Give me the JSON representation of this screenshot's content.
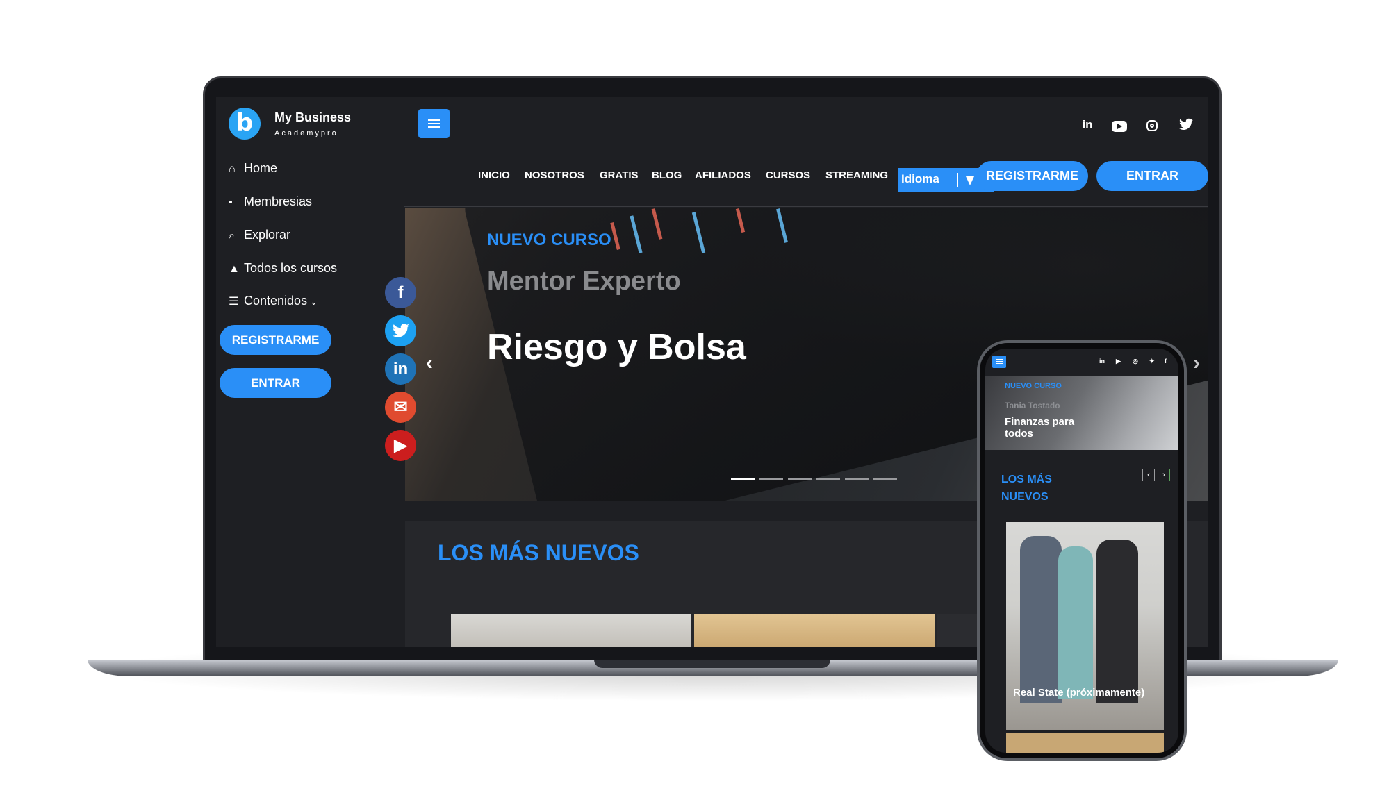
{
  "brand": {
    "name": "My Business",
    "sub": "Academypro",
    "logo_letter": "b"
  },
  "top_social": [
    "linkedin-icon",
    "youtube-icon",
    "instagram-icon",
    "twitter-icon"
  ],
  "nav": {
    "items": [
      "INICIO",
      "NOSOTROS",
      "GRATIS",
      "BLOG",
      "AFILIADOS",
      "CURSOS",
      "STREAMING"
    ],
    "idioma": "Idioma",
    "register": "REGISTRARME",
    "login": "ENTRAR"
  },
  "sidebar": {
    "items": [
      {
        "label": "Home",
        "icon": "home-icon"
      },
      {
        "label": "Membresias",
        "icon": "bag-icon"
      },
      {
        "label": "Explorar",
        "icon": "search-icon"
      },
      {
        "label": "Todos los cursos",
        "icon": "graduation-cap-icon"
      },
      {
        "label": "Contenidos",
        "icon": "list-icon"
      }
    ],
    "register": "REGISTRARME",
    "login": "ENTRAR"
  },
  "share_icons": [
    "facebook-icon",
    "twitter-icon",
    "linkedin-icon",
    "email-icon",
    "youtube-icon"
  ],
  "hero": {
    "tag": "NUEVO CURSO",
    "subtitle": "Mentor Experto",
    "title": "Riesgo y Bolsa"
  },
  "section": {
    "title": "LOS MÁS NUEVOS"
  },
  "phone": {
    "hero_tag": "NUEVO CURSO",
    "hero_sub": "Tania Tostado",
    "hero_title": "Finanzas para todos",
    "section_title": "LOS MÁS NUEVOS",
    "card_title": "Real State (próximamente)"
  },
  "colors": {
    "accent": "#2a8ff7",
    "background": "#1e1f23",
    "text": "#ffffff"
  }
}
